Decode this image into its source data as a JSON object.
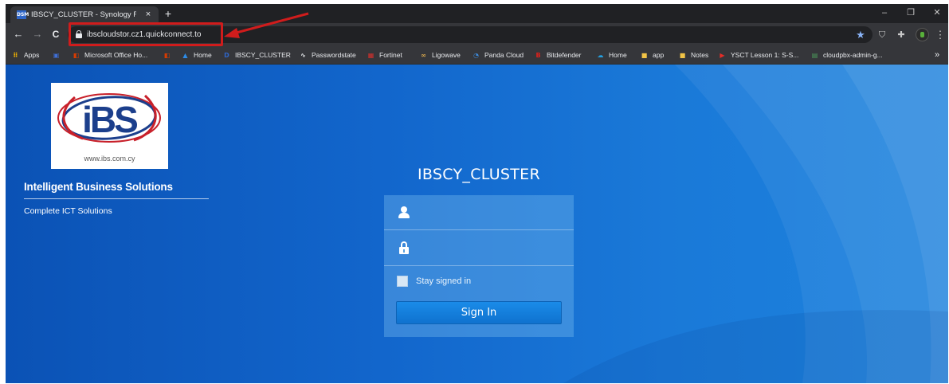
{
  "browser": {
    "tab": {
      "favicon_text": "DSM",
      "title": "IBSCY_CLUSTER - Synology Rack",
      "close_glyph": "×"
    },
    "new_tab_glyph": "+",
    "window_controls": {
      "minimize": "–",
      "maximize": "❐",
      "close": "✕"
    },
    "toolbar": {
      "back_glyph": "←",
      "forward_glyph": "→",
      "reload_glyph": "C",
      "url": "ibscloudstor.cz1.quickconnect.to",
      "star_glyph": "★",
      "menu_glyph": "⋮"
    },
    "bookmarks": [
      {
        "label": "Apps",
        "icon": "apps-grid-icon",
        "color": "#f4b400",
        "glyph": "⠿"
      },
      {
        "label": "",
        "icon": "bookmark-icon",
        "color": "#3f6fd6",
        "glyph": "▣"
      },
      {
        "label": "Microsoft Office Ho...",
        "icon": "office-icon",
        "color": "#d83b01",
        "glyph": "◧"
      },
      {
        "label": "",
        "icon": "office-icon",
        "color": "#d83b01",
        "glyph": "◧"
      },
      {
        "label": "Home",
        "icon": "azure-icon",
        "color": "#2d8be6",
        "glyph": "▲"
      },
      {
        "label": "IBSCY_CLUSTER",
        "icon": "dsm-icon",
        "color": "#2f66c8",
        "glyph": "D"
      },
      {
        "label": "Passwordstate",
        "icon": "pulse-icon",
        "color": "#e8eaed",
        "glyph": "∿"
      },
      {
        "label": "Fortinet",
        "icon": "fortinet-icon",
        "color": "#d9302c",
        "glyph": "▦"
      },
      {
        "label": "Ligowave",
        "icon": "ligowave-icon",
        "color": "#d6a64d",
        "glyph": "∞"
      },
      {
        "label": "Panda Cloud",
        "icon": "panda-icon",
        "color": "#3d8de0",
        "glyph": "◔"
      },
      {
        "label": "Bitdefender",
        "icon": "bitdefender-icon",
        "color": "#e0201a",
        "glyph": "B"
      },
      {
        "label": "Home",
        "icon": "salesforce-icon",
        "color": "#25a0e0",
        "glyph": "☁"
      },
      {
        "label": "app",
        "icon": "folder-icon",
        "color": "#f2c446",
        "glyph": "■"
      },
      {
        "label": "Notes",
        "icon": "folder-icon",
        "color": "#f2c446",
        "glyph": "■"
      },
      {
        "label": "YSCT Lesson 1: S-S...",
        "icon": "youtube-icon",
        "color": "#e52d27",
        "glyph": "▶"
      },
      {
        "label": "cloudpbx-admin-g...",
        "icon": "pbx-icon",
        "color": "#4a9a5a",
        "glyph": "▤"
      },
      {
        "label": "»",
        "icon": "more-bookmarks-icon",
        "color": "#e8eaed",
        "glyph": ""
      }
    ]
  },
  "page": {
    "logo": {
      "text": "iBS",
      "url": "www.ibs.com.cy"
    },
    "tagline": "Intelligent Business Solutions",
    "subtagline": "Complete ICT Solutions",
    "server_name": "IBSCY_CLUSTER",
    "login": {
      "username_value": "",
      "password_value": "",
      "stay_signed_in_label": "Stay signed in",
      "sign_in_label": "Sign In"
    }
  },
  "colors": {
    "annotation_red": "#d01c1c",
    "page_blue": "#1266cc",
    "sign_in_blue": "#0f72cf"
  }
}
